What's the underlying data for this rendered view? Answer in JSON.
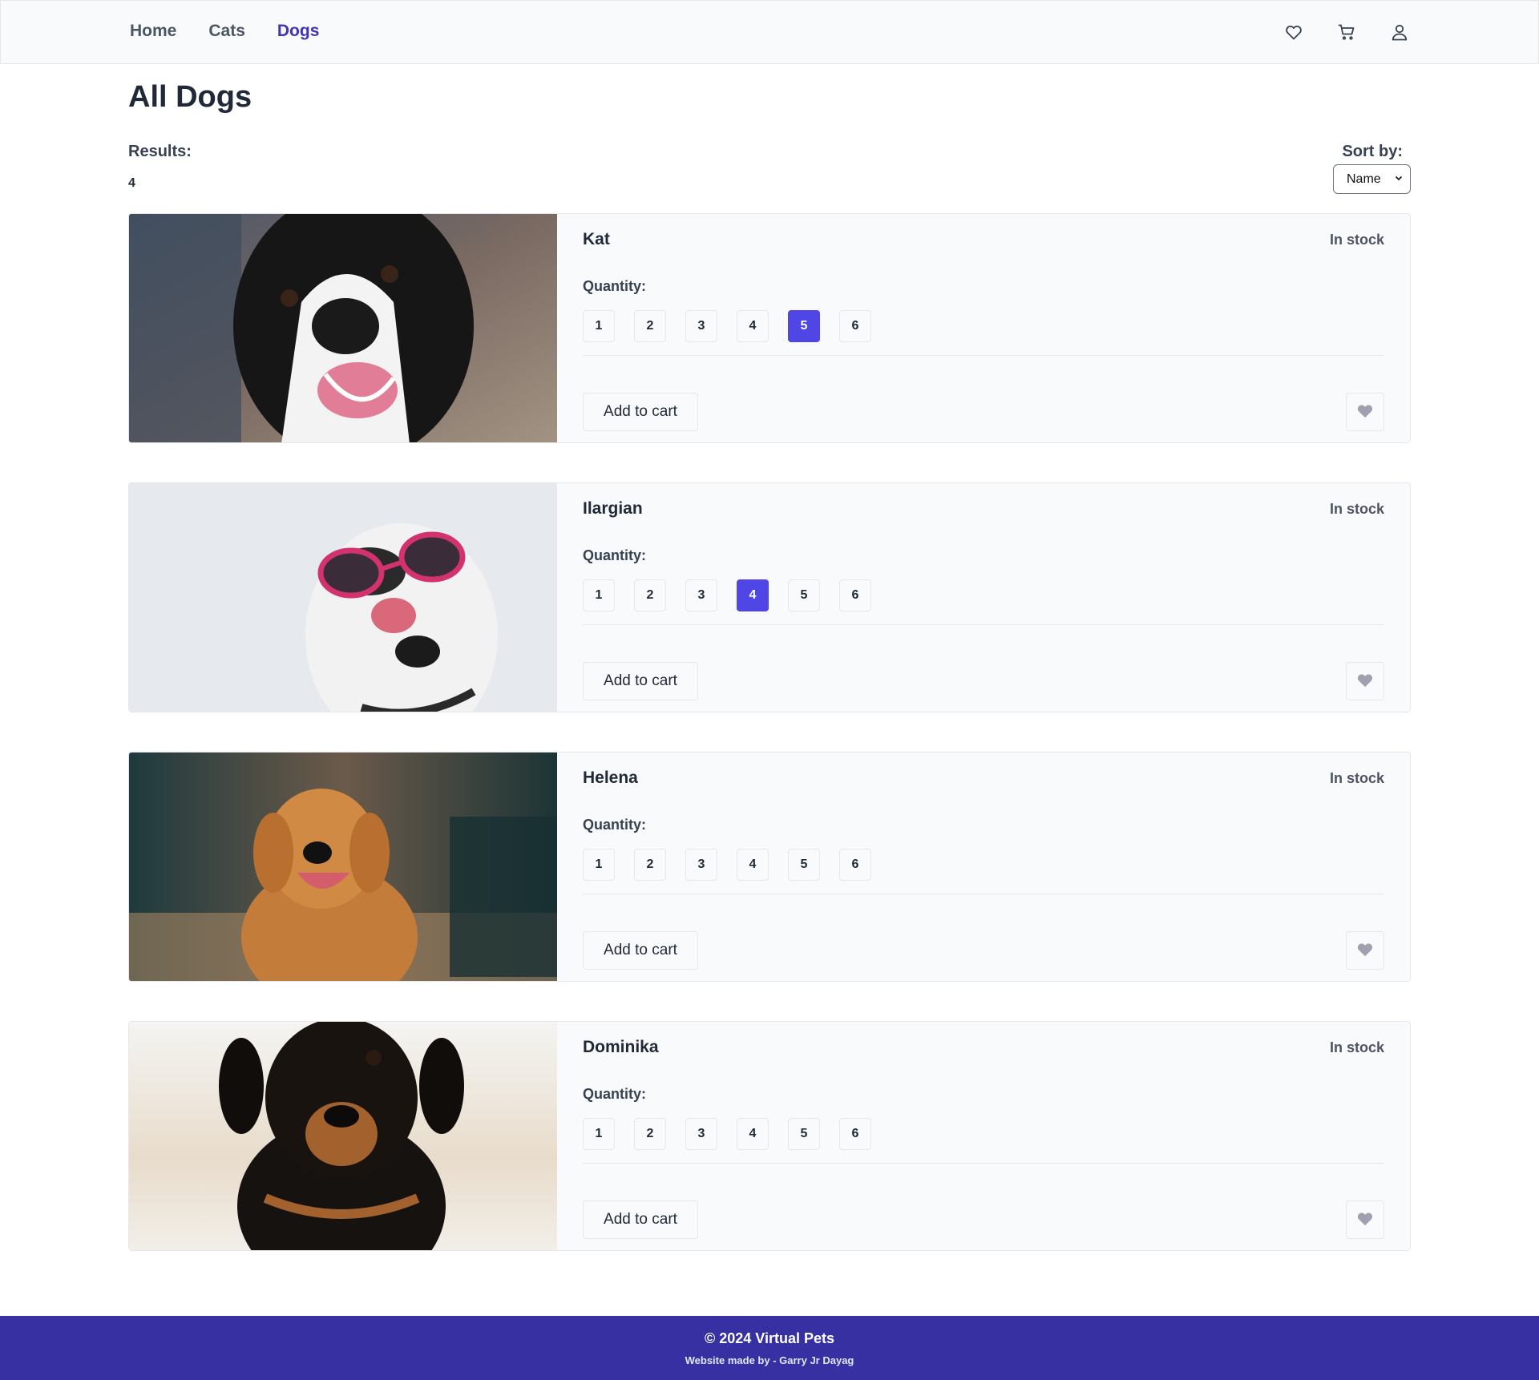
{
  "nav": {
    "links": [
      {
        "label": "Home",
        "active": false
      },
      {
        "label": "Cats",
        "active": false
      },
      {
        "label": "Dogs",
        "active": true
      }
    ],
    "icons": [
      "heart-icon",
      "cart-icon",
      "user-icon"
    ]
  },
  "main": {
    "title": "All Dogs",
    "results_label": "Results:",
    "results_count": "4",
    "sort_label": "Sort by:",
    "sort_selected": "Name"
  },
  "pets": [
    {
      "name": "Kat",
      "stock": "In stock",
      "qty_label": "Quantity:",
      "quantities": [
        "1",
        "2",
        "3",
        "4",
        "5",
        "6"
      ],
      "selected_qty": "5",
      "add_label": "Add to cart",
      "image": "dog-photo-black-white"
    },
    {
      "name": "Ilargian",
      "stock": "In stock",
      "qty_label": "Quantity:",
      "quantities": [
        "1",
        "2",
        "3",
        "4",
        "5",
        "6"
      ],
      "selected_qty": "4",
      "add_label": "Add to cart",
      "image": "dog-photo-sunglasses"
    },
    {
      "name": "Helena",
      "stock": "In stock",
      "qty_label": "Quantity:",
      "quantities": [
        "1",
        "2",
        "3",
        "4",
        "5",
        "6"
      ],
      "selected_qty": null,
      "add_label": "Add to cart",
      "image": "dog-photo-golden"
    },
    {
      "name": "Dominika",
      "stock": "In stock",
      "qty_label": "Quantity:",
      "quantities": [
        "1",
        "2",
        "3",
        "4",
        "5",
        "6"
      ],
      "selected_qty": null,
      "add_label": "Add to cart",
      "image": "dog-photo-puppy"
    }
  ],
  "footer": {
    "main": "© 2024 Virtual Pets",
    "sub": "Website made by - Garry Jr Dayag"
  },
  "colors": {
    "accent": "#4f46e5",
    "active_link": "#3f33b8",
    "footer_bg": "#3730a3"
  }
}
